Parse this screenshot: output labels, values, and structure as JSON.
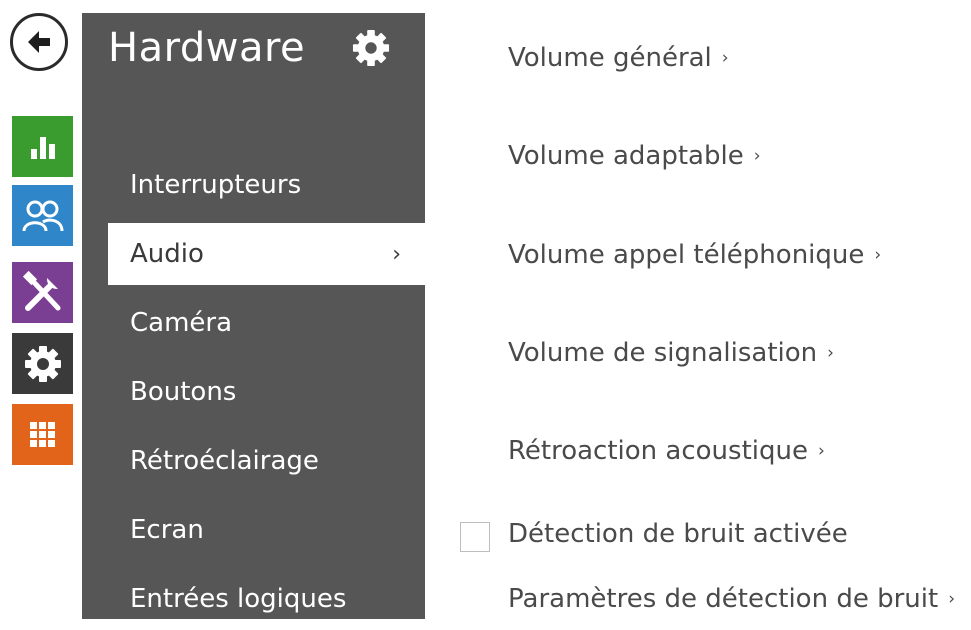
{
  "rail": {
    "back_icon": "arrow-left-icon",
    "items": [
      {
        "icon": "status-chart-icon",
        "color": "#3a9b2e"
      },
      {
        "icon": "users-icon",
        "color": "#2f86c8"
      },
      {
        "icon": "services-tools-icon",
        "color": "#7a3f93"
      },
      {
        "icon": "hardware-gear-icon",
        "color": "#3a3a3a"
      },
      {
        "icon": "system-grid-icon",
        "color": "#e2641a"
      }
    ]
  },
  "panel": {
    "title": "Hardware",
    "title_icon": "gear-icon",
    "background": "#565656",
    "items": [
      {
        "label": "Interrupteurs"
      },
      {
        "label": "Audio",
        "active": true,
        "chevron": "›"
      },
      {
        "label": "Caméra"
      },
      {
        "label": "Boutons"
      },
      {
        "label": "Rétroéclairage"
      },
      {
        "label": "Ecran"
      },
      {
        "label": "Entrées logiques"
      }
    ]
  },
  "content": {
    "links": [
      {
        "label": "Volume général",
        "chevron": "›"
      },
      {
        "label": "Volume adaptable",
        "chevron": "›"
      },
      {
        "label": "Volume appel téléphonique",
        "chevron": "›"
      },
      {
        "label": "Volume de signalisation",
        "chevron": "›"
      },
      {
        "label": "Rétroaction acoustique",
        "chevron": "›"
      }
    ],
    "checkbox": {
      "label": "Détection de bruit activée",
      "checked": false
    },
    "bottom_link": {
      "label": "Paramètres de détection de bruit",
      "chevron": "›"
    }
  }
}
